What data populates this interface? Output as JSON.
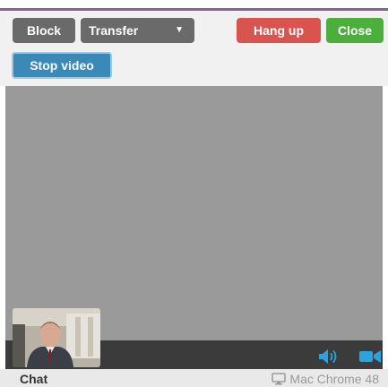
{
  "toolbar": {
    "block_label": "Block",
    "transfer_label": "Transfer",
    "hangup_label": "Hang up",
    "close_label": "Close",
    "stop_video_label": "Stop video"
  },
  "video": {
    "controls": {
      "volume_icon": "volume-icon",
      "camera_icon": "camera-icon"
    }
  },
  "footer": {
    "chat_label": "Chat",
    "client_info": "Mac Chrome 48",
    "client_icon": "monitor-icon"
  },
  "colors": {
    "accent": "#8a5d97",
    "neutral_button": "#6a6a6a",
    "hangup_button": "#d9534f",
    "close_button": "#4caf3c",
    "stop_video_button": "#3a89b6",
    "icon_blue": "#2aa3e0"
  }
}
